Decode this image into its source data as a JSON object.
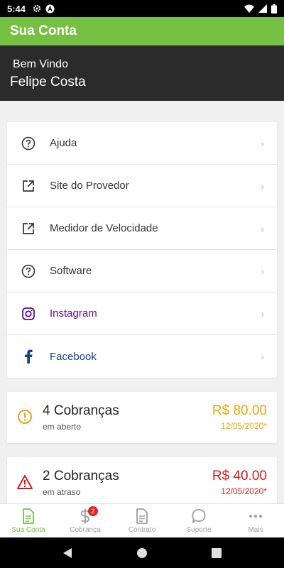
{
  "status_bar": {
    "time": "5:44"
  },
  "app_bar": {
    "title": "Sua Conta"
  },
  "welcome": {
    "greeting": "Bem Vindo",
    "user_name": "Felipe Costa"
  },
  "menu": {
    "items": [
      {
        "label": "Ajuda",
        "icon": "help-circle-icon"
      },
      {
        "label": "Site do Provedor",
        "icon": "external-link-icon"
      },
      {
        "label": "Medidor de Velocidade",
        "icon": "external-link-icon"
      },
      {
        "label": "Software",
        "icon": "help-circle-icon"
      },
      {
        "label": "Instagram",
        "icon": "instagram-icon"
      },
      {
        "label": "Facebook",
        "icon": "facebook-icon"
      }
    ],
    "chevron": "›"
  },
  "bills": {
    "open": {
      "count": "4 Cobranças",
      "status": "em aberto",
      "amount": "R$ 80.00",
      "due": "12/05/2020*",
      "color": "#f0a30a"
    },
    "late": {
      "count": "2 Cobranças",
      "status": "em atraso",
      "amount": "R$ 40.00",
      "due": "12/05/2020*",
      "color": "#d81b1b"
    }
  },
  "bottom_nav": {
    "items": [
      {
        "label": "Sua Conta",
        "active": true
      },
      {
        "label": "Cobrança",
        "badge": "2"
      },
      {
        "label": "Contrato"
      },
      {
        "label": "Suporte"
      },
      {
        "label": "Mais"
      }
    ]
  },
  "colors": {
    "accent": "#76c043",
    "header_dark": "#2b2b2b"
  }
}
